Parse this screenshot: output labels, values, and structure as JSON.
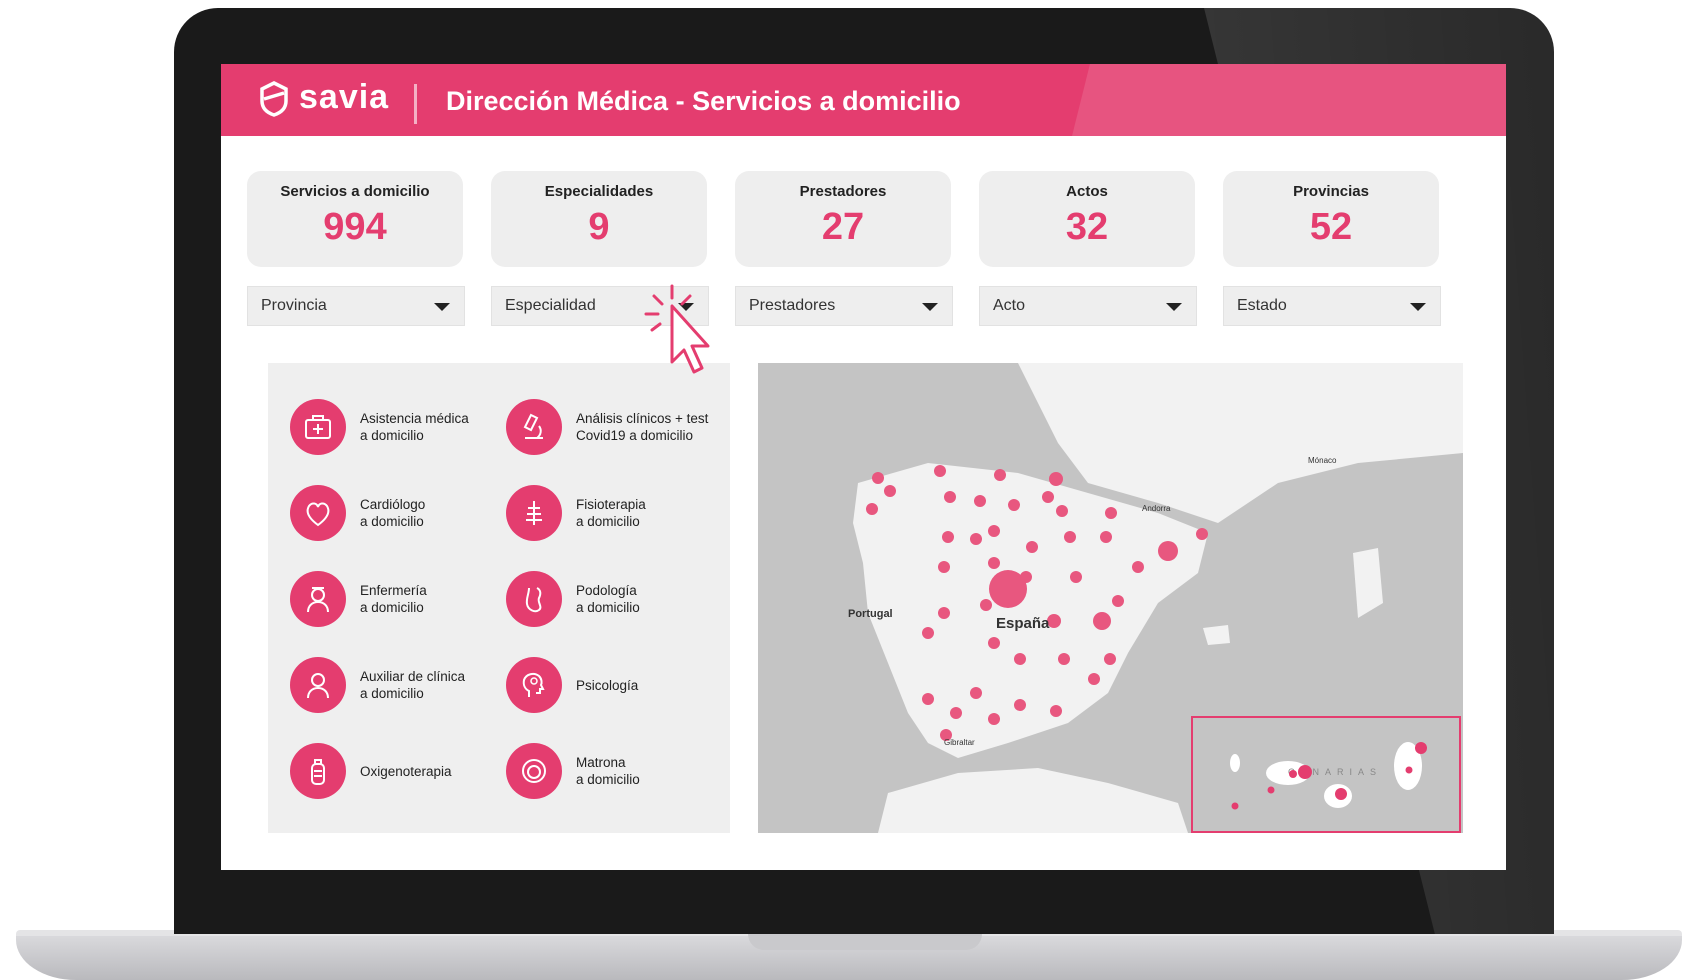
{
  "brand": {
    "name": "savia",
    "color": "#e43d6f"
  },
  "header": {
    "title": "Dirección Médica - Servicios a domicilio"
  },
  "kpis": [
    {
      "label": "Servicios a domicilio",
      "value": "994"
    },
    {
      "label": "Especialidades",
      "value": "9"
    },
    {
      "label": "Prestadores",
      "value": "27"
    },
    {
      "label": "Actos",
      "value": "32"
    },
    {
      "label": "Provincias",
      "value": "52"
    }
  ],
  "filters": [
    {
      "label": "Provincia"
    },
    {
      "label": "Especialidad"
    },
    {
      "label": "Prestadores"
    },
    {
      "label": "Acto"
    },
    {
      "label": "Estado"
    }
  ],
  "services": [
    {
      "label": "Asistencia médica\na domicilio",
      "icon": "first-aid-kit-icon"
    },
    {
      "label": "Análisis clínicos + test\nCovid19 a domicilio",
      "icon": "microscope-icon"
    },
    {
      "label": "Cardiólogo\na domicilio",
      "icon": "heart-icon"
    },
    {
      "label": "Fisioterapia\na domicilio",
      "icon": "spine-icon"
    },
    {
      "label": "Enfermería\na domicilio",
      "icon": "nurse-icon"
    },
    {
      "label": "Podología\na domicilio",
      "icon": "foot-icon"
    },
    {
      "label": "Auxiliar de clínica\na domicilio",
      "icon": "assistant-icon"
    },
    {
      "label": "Psicología",
      "icon": "brain-head-icon"
    },
    {
      "label": "Oxigenoterapia",
      "icon": "oxygen-tank-icon"
    },
    {
      "label": "Matrona\na domicilio",
      "icon": "baby-icon"
    }
  ],
  "map": {
    "labels": {
      "spain": "España",
      "portugal": "Portugal",
      "andorra": "Andorra",
      "monaco": "Mónaco",
      "gibraltar": "Gibraltar",
      "canarias": "CANARIAS"
    }
  }
}
